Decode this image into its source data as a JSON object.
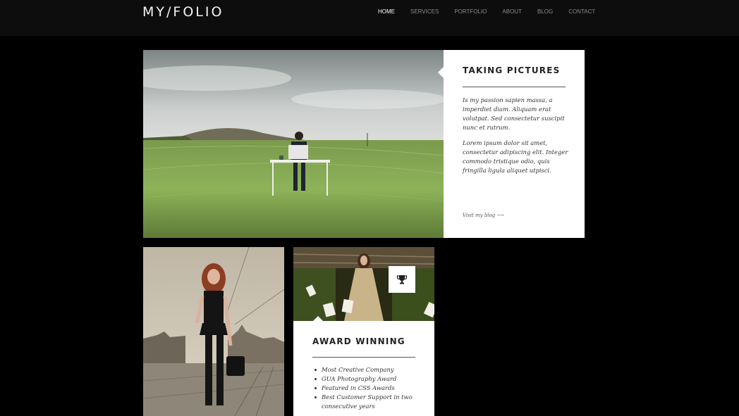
{
  "header": {
    "logo": "MY/FOLIO",
    "nav": [
      "HOME",
      "SERVICES",
      "PORTFOLIO",
      "ABOUT",
      "BLOG",
      "CONTACT"
    ],
    "active_index": 0
  },
  "feature": {
    "title": "TAKING PICTURES",
    "paragraph1": "Is my passion sapien massa, a imperdiet diam. Aliquam erat volutpat. Sed consectetur suscipit nunc et rutrum.",
    "paragraph2": "Lorem ipsum dolor sit amet, consectetur adipiscing elit. Integer commodo tristique odio, quis fringilla ligula aliquet utpisci.",
    "link": "Visit my blog ⟶"
  },
  "award": {
    "title": "AWARD WINNING",
    "items": [
      "Most Creative Company",
      "GUA Photography Award",
      "Featured in CSS Awards",
      "Best Customer Support in two consecutive years"
    ]
  },
  "icons": {
    "trophy": "trophy-icon"
  },
  "colors": {
    "background": "#000000",
    "header": "#0d0d0d",
    "card": "#ffffff",
    "text": "#333333",
    "nav_inactive": "#8a8a8a",
    "nav_active": "#ffffff"
  }
}
